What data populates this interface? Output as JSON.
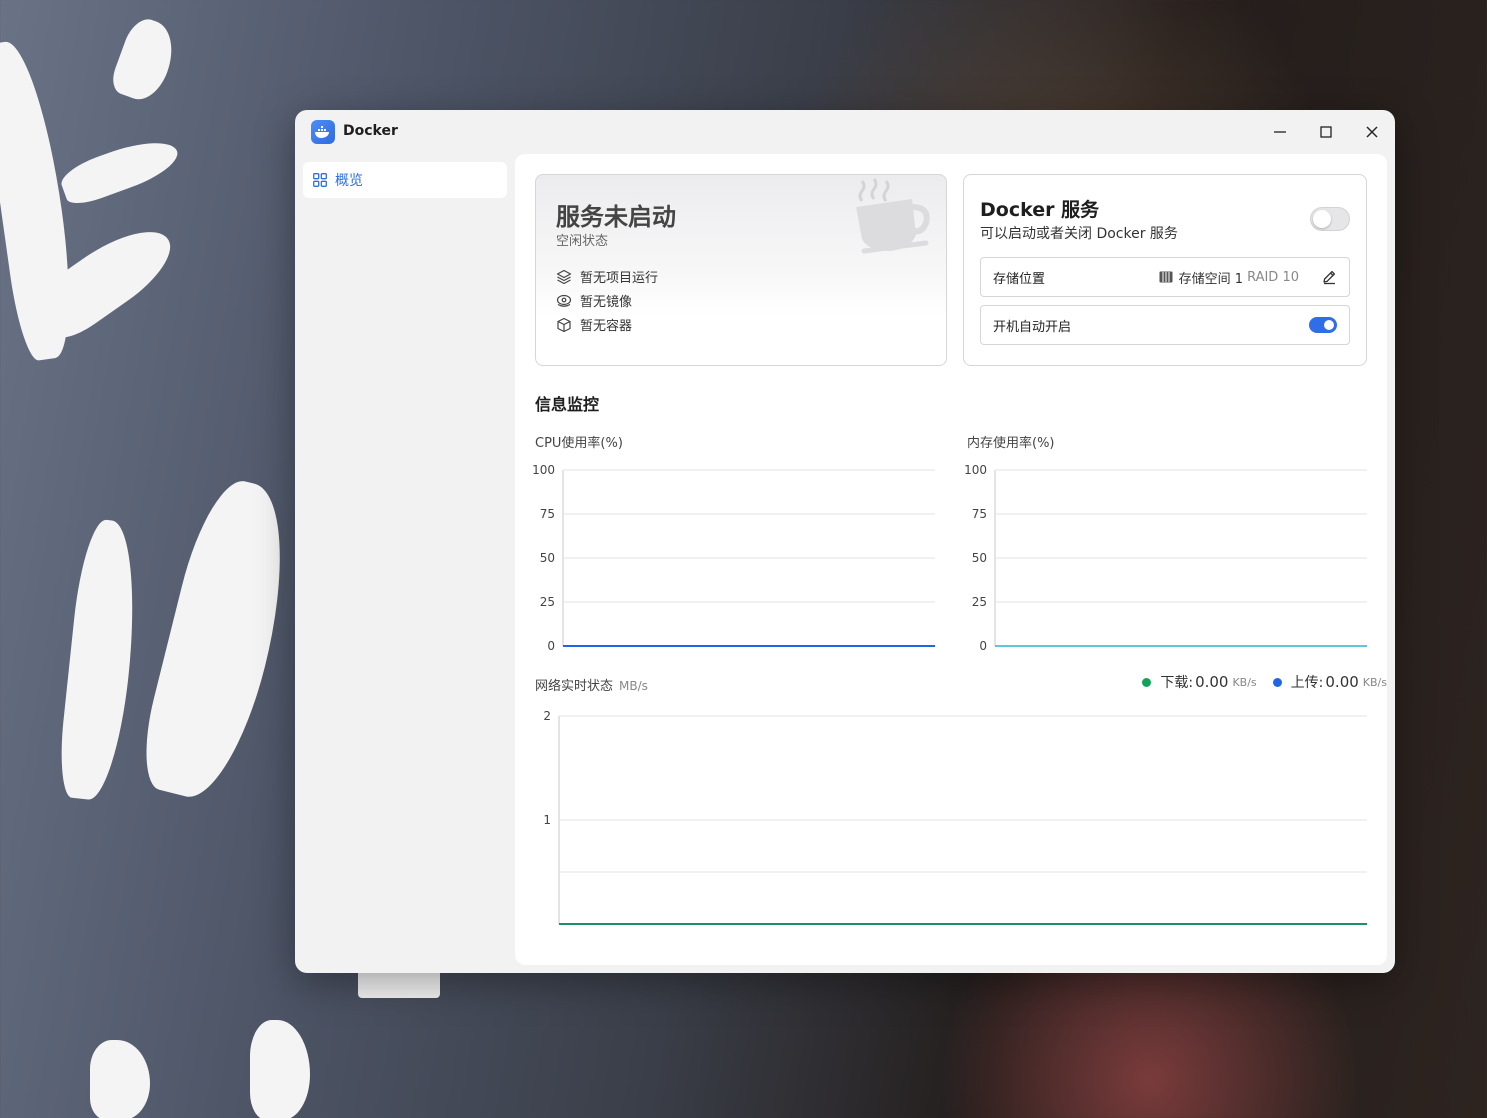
{
  "window": {
    "title": "Docker",
    "buttons": {
      "minimize": "minimize-icon",
      "maximize": "maximize-icon",
      "close": "close-icon"
    }
  },
  "sidebar": {
    "items": [
      {
        "label": "概览",
        "icon": "grid-icon",
        "active": true
      }
    ]
  },
  "status_card": {
    "title": "服务未启动",
    "subtitle": "空闲状态",
    "rows": [
      {
        "icon": "layers-icon",
        "label": "暂无项目运行"
      },
      {
        "icon": "disc-icon",
        "label": "暂无镜像"
      },
      {
        "icon": "cube-icon",
        "label": "暂无容器"
      }
    ]
  },
  "service_card": {
    "title": "Docker 服务",
    "description": "可以启动或者关闭 Docker 服务",
    "enabled": false,
    "storage": {
      "label": "存储位置",
      "value": "存储空间 1",
      "raid": "RAID 10"
    },
    "autostart": {
      "label": "开机自动开启",
      "enabled": true
    }
  },
  "monitor": {
    "title": "信息监控",
    "cpu_label": "CPU使用率(%)",
    "mem_label": "内存使用率(%)",
    "net_label": "网络实时状态",
    "net_unit": "MB/s",
    "download": {
      "label": "下载:",
      "value": "0.00",
      "unit": "KB/s",
      "color": "#12a35a"
    },
    "upload": {
      "label": "上传:",
      "value": "0.00",
      "unit": "KB/s",
      "color": "#1f66e5"
    }
  },
  "colors": {
    "accent": "#2f6ee6",
    "cpu_line": "#1f66e5",
    "mem_line": "#5ec8d8",
    "net_line": "#1e8f6e"
  },
  "chart_data": [
    {
      "type": "line",
      "title": "CPU使用率(%)",
      "ylim": [
        0,
        100
      ],
      "yticks": [
        "100",
        "75",
        "50",
        "25",
        "0"
      ],
      "series": [
        {
          "values": [
            0,
            0
          ]
        }
      ]
    },
    {
      "type": "line",
      "title": "内存使用率(%)",
      "ylim": [
        0,
        100
      ],
      "yticks": [
        "100",
        "75",
        "50",
        "25",
        "0"
      ],
      "series": [
        {
          "values": [
            0,
            0
          ]
        }
      ]
    },
    {
      "type": "line",
      "title": "网络实时状态",
      "ylim": [
        0,
        2
      ],
      "yticks": [
        "2",
        "1"
      ],
      "series": [
        {
          "values": [
            0,
            0
          ]
        }
      ]
    }
  ]
}
